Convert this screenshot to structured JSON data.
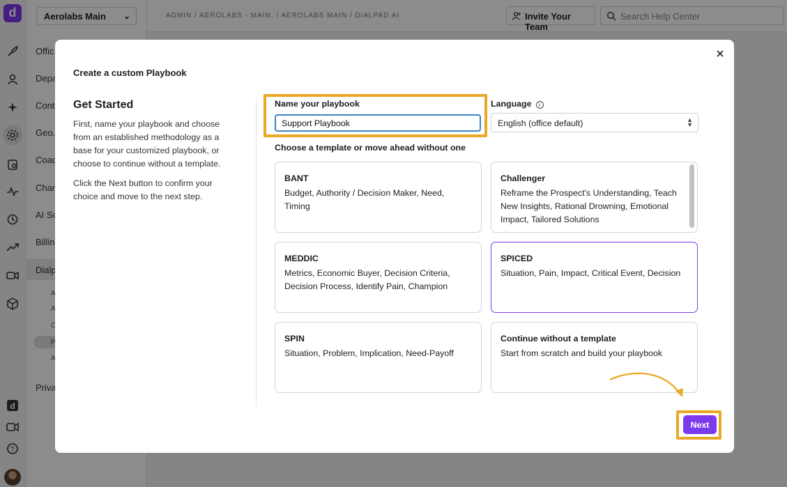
{
  "app": {
    "org_selector": "Aerolabs Main",
    "breadcrumb": "ADMIN / AEROLABS - MAIN. / AEROLABS MAIN / DIALPAD AI",
    "invite_button": "Invite Your Team",
    "search_placeholder": "Search Help Center",
    "nav_items": [
      "Offic",
      "Depa",
      "Conta",
      "Geo.",
      "Coac",
      "Chan",
      "AI Sc",
      "Billin",
      "Dialp",
      "Priva"
    ],
    "nav_subitems": [
      "A",
      "A",
      "C",
      "P",
      "A"
    ]
  },
  "modal": {
    "title": "Create a custom Playbook",
    "left": {
      "heading": "Get Started",
      "paragraph1": "First, name your playbook and choose from an established methodology as a base for your customized playbook, or choose to continue without a template.",
      "paragraph2": "Click the Next button to confirm your choice and move to the next step."
    },
    "name_label": "Name your playbook",
    "name_value": "Support Playbook",
    "language_label": "Language",
    "language_value": "English (office default)",
    "template_heading": "Choose a template or move ahead without one",
    "templates": [
      {
        "title": "BANT",
        "desc": "Budget, Authority / Decision Maker, Need, Timing"
      },
      {
        "title": "Challenger",
        "desc": "Reframe the Prospect's Understanding, Teach New Insights, Rational Drowning, Emotional Impact, Tailored Solutions"
      },
      {
        "title": "MEDDIC",
        "desc": "Metrics, Economic Buyer, Decision Criteria, Decision Process, Identify Pain, Champion"
      },
      {
        "title": "SPICED",
        "desc": "Situation, Pain, Impact, Critical Event, Decision"
      },
      {
        "title": "SPIN",
        "desc": "Situation, Problem, Implication, Need-Payoff"
      },
      {
        "title": "Continue without a template",
        "desc": "Start from scratch and build your playbook"
      }
    ],
    "selected_template": "SPICED",
    "next_button": "Next"
  },
  "colors": {
    "accent": "#7c3aed",
    "highlight": "#e9a825",
    "input_focus": "#3a86c6"
  }
}
